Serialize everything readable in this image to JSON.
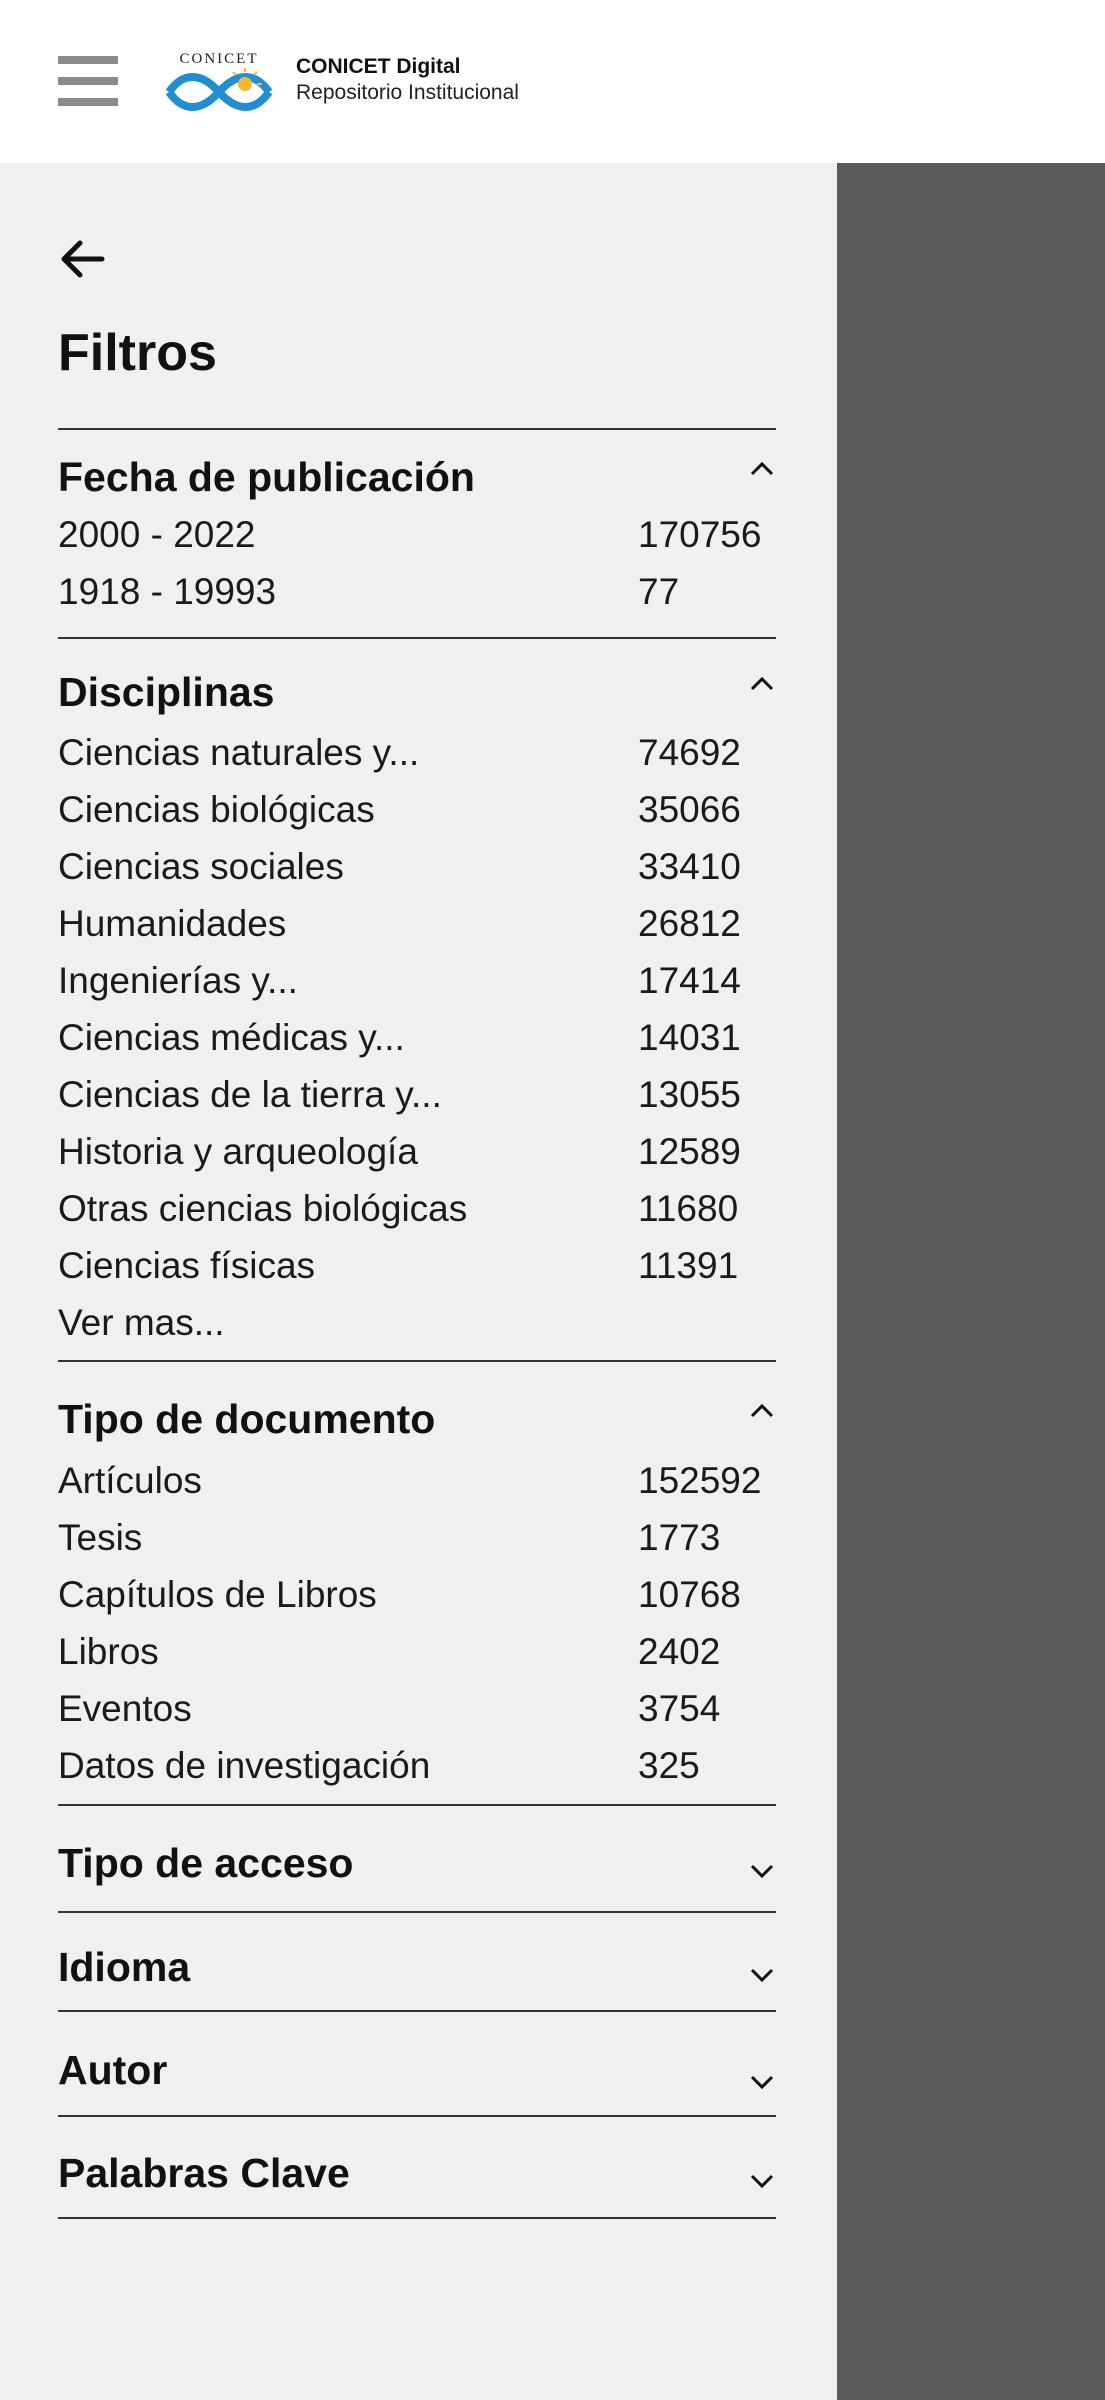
{
  "header": {
    "logo_text": "CONICET",
    "title": "CONICET Digital",
    "subtitle": "Repositorio Institucional",
    "menu_icon": "hamburger-menu-icon"
  },
  "panel": {
    "back_icon": "arrow-left-icon",
    "title": "Filtros",
    "sections": {
      "fecha": {
        "title": "Fecha de publicación",
        "expanded": true,
        "items": [
          {
            "label": "2000 - 2022",
            "count": "170756"
          },
          {
            "label": "1918 - 19993",
            "count": "77"
          }
        ]
      },
      "disciplinas": {
        "title": "Disciplinas",
        "expanded": true,
        "items": [
          {
            "label": "Ciencias naturales y...",
            "count": "74692"
          },
          {
            "label": "Ciencias biológicas",
            "count": "35066"
          },
          {
            "label": "Ciencias sociales",
            "count": "33410"
          },
          {
            "label": "Humanidades",
            "count": "26812"
          },
          {
            "label": "Ingenierías y...",
            "count": "17414"
          },
          {
            "label": "Ciencias médicas y...",
            "count": "14031"
          },
          {
            "label": "Ciencias de la tierra y...",
            "count": "13055"
          },
          {
            "label": "Historia y arqueología",
            "count": "12589"
          },
          {
            "label": "Otras ciencias biológicas",
            "count": "11680"
          },
          {
            "label": "Ciencias físicas",
            "count": "11391"
          }
        ],
        "more": "Ver mas..."
      },
      "tipo_documento": {
        "title": "Tipo de documento",
        "expanded": true,
        "items": [
          {
            "label": "Artículos",
            "count": "152592"
          },
          {
            "label": "Tesis",
            "count": "1773"
          },
          {
            "label": "Capítulos de Libros",
            "count": "10768"
          },
          {
            "label": "Libros",
            "count": "2402"
          },
          {
            "label": "Eventos",
            "count": "3754"
          },
          {
            "label": "Datos de investigación",
            "count": "325"
          }
        ]
      },
      "tipo_acceso": {
        "title": "Tipo de acceso",
        "expanded": false
      },
      "idioma": {
        "title": "Idioma",
        "expanded": false
      },
      "autor": {
        "title": "Autor",
        "expanded": false
      },
      "palabras_clave": {
        "title": "Palabras Clave",
        "expanded": false
      }
    }
  },
  "colors": {
    "panel_bg": "#f0f0f0",
    "overlay": "#5c5a5b",
    "logo_blue": "#1f8fd1",
    "logo_sun": "#f5b82e"
  }
}
